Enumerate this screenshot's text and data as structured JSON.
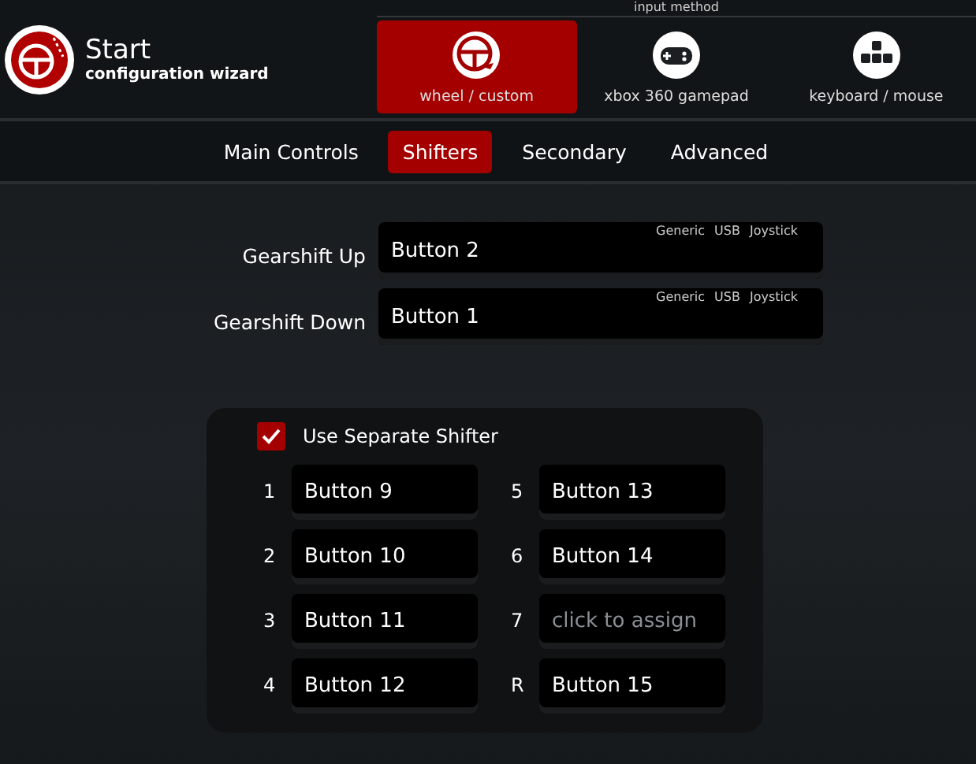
{
  "header": {
    "title": "Start",
    "subtitle": "configuration wizard"
  },
  "input_method": {
    "label": "input method",
    "options": [
      {
        "label": "wheel / custom",
        "kind": "wheel",
        "selected": true
      },
      {
        "label": "xbox 360 gamepad",
        "kind": "gamepad",
        "selected": false
      },
      {
        "label": "keyboard / mouse",
        "kind": "keyboard",
        "selected": false
      }
    ]
  },
  "tabs": [
    {
      "label": "Main Controls",
      "selected": false
    },
    {
      "label": "Shifters",
      "selected": true
    },
    {
      "label": "Secondary",
      "selected": false
    },
    {
      "label": "Advanced",
      "selected": false
    }
  ],
  "bindings": [
    {
      "label": "Gearshift Up",
      "value": "Button 2",
      "device": [
        "Generic",
        "USB",
        "Joystick"
      ]
    },
    {
      "label": "Gearshift Down",
      "value": "Button 1",
      "device": [
        "Generic",
        "USB",
        "Joystick"
      ]
    }
  ],
  "separate_shifter": {
    "label": "Use Separate Shifter",
    "checked": true,
    "gears": [
      {
        "gear": "1",
        "value": "Button 9",
        "assigned": true
      },
      {
        "gear": "2",
        "value": "Button 10",
        "assigned": true
      },
      {
        "gear": "3",
        "value": "Button 11",
        "assigned": true
      },
      {
        "gear": "4",
        "value": "Button 12",
        "assigned": true
      },
      {
        "gear": "5",
        "value": "Button 13",
        "assigned": true
      },
      {
        "gear": "6",
        "value": "Button 14",
        "assigned": true
      },
      {
        "gear": "7",
        "value": "click to assign",
        "assigned": false
      },
      {
        "gear": "R",
        "value": "Button 15",
        "assigned": true
      }
    ]
  }
}
